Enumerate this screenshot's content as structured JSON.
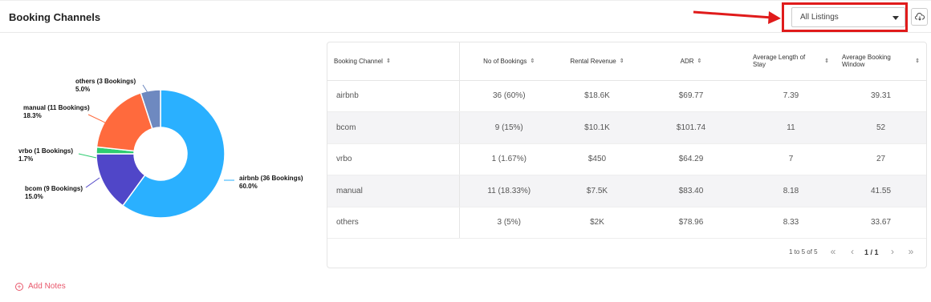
{
  "header": {
    "title": "Booking Channels",
    "listing_select": {
      "value": "All Listings"
    },
    "download_icon": "cloud-download-icon"
  },
  "colors": {
    "highlight_box": "#e01b1b",
    "airbnb": "#2ab0ff",
    "bcom": "#5046c8",
    "vrbo": "#2ecc71",
    "manual": "#ff6a3d",
    "others": "#6e89c0",
    "notes_accent": "#e8566a"
  },
  "chart_data": {
    "type": "pie",
    "variant": "donut",
    "slices": [
      {
        "label": "airbnb (36 Bookings)",
        "pct_label": "60.0%",
        "value": 60.0
      },
      {
        "label": "bcom (9 Bookings)",
        "pct_label": "15.0%",
        "value": 15.0
      },
      {
        "label": "vrbo (1 Bookings)",
        "pct_label": "1.7%",
        "value": 1.7
      },
      {
        "label": "manual (11 Bookings)",
        "pct_label": "18.3%",
        "value": 18.3
      },
      {
        "label": "others (3 Bookings)",
        "pct_label": "5.0%",
        "value": 5.0
      }
    ]
  },
  "table": {
    "columns": [
      "Booking Channel",
      "No of Bookings",
      "Rental Revenue",
      "ADR",
      "Average Length of Stay",
      "Average Booking Window"
    ],
    "rows": [
      [
        "airbnb",
        "36 (60%)",
        "$18.6K",
        "$69.77",
        "7.39",
        "39.31"
      ],
      [
        "bcom",
        "9 (15%)",
        "$10.1K",
        "$101.74",
        "11",
        "52"
      ],
      [
        "vrbo",
        "1 (1.67%)",
        "$450",
        "$64.29",
        "7",
        "27"
      ],
      [
        "manual",
        "11 (18.33%)",
        "$7.5K",
        "$83.40",
        "8.18",
        "41.55"
      ],
      [
        "others",
        "3 (5%)",
        "$2K",
        "$78.96",
        "8.33",
        "33.67"
      ]
    ]
  },
  "pagination": {
    "count": "1 to 5 of 5",
    "page": "1 / 1"
  },
  "footer": {
    "add_notes": "Add Notes"
  }
}
